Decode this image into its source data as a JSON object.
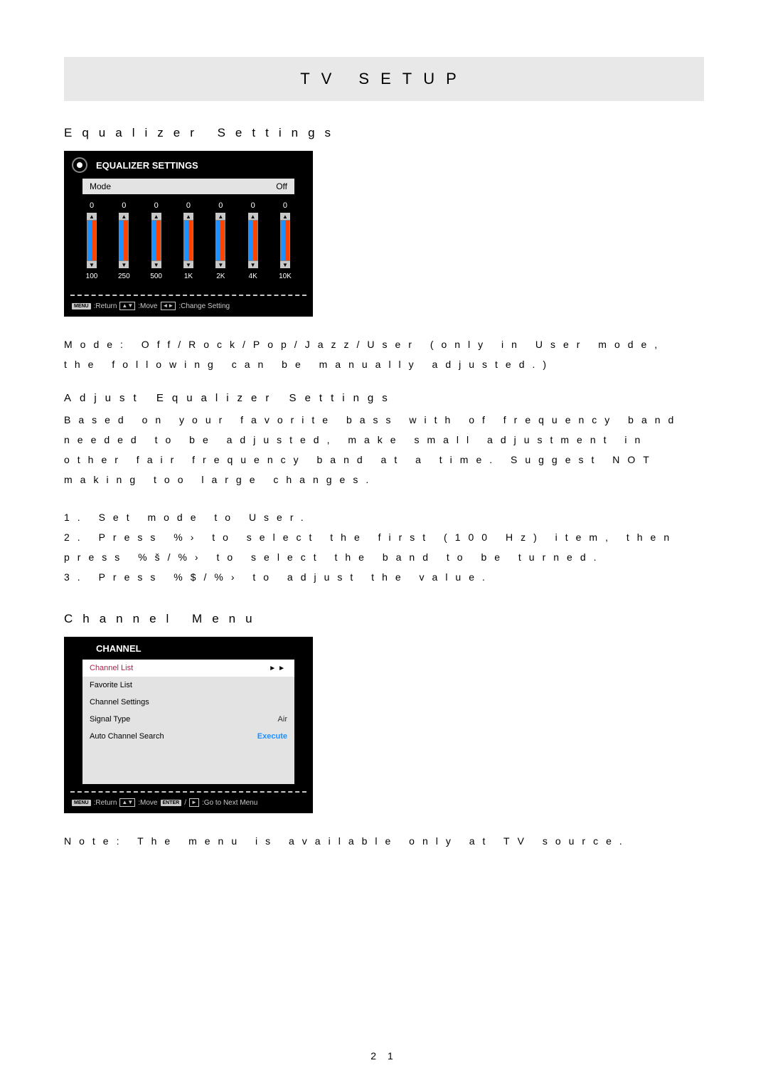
{
  "title": "TV SETUP",
  "equalizer": {
    "heading": "Equalizer Settings",
    "panel_title": "EQUALIZER SETTINGS",
    "mode_label": "Mode",
    "mode_value": "Off",
    "bands": [
      {
        "value": "0",
        "freq": "100"
      },
      {
        "value": "0",
        "freq": "250"
      },
      {
        "value": "0",
        "freq": "500"
      },
      {
        "value": "0",
        "freq": "1K"
      },
      {
        "value": "0",
        "freq": "2K"
      },
      {
        "value": "0",
        "freq": "4K"
      },
      {
        "value": "0",
        "freq": "10K"
      }
    ],
    "footer_return": ":Return",
    "footer_move": ":Move",
    "footer_change": ":Change Setting",
    "key_menu": "MENU"
  },
  "mode_text": "Mode: Off/Rock/Pop/Jazz/User (only in User mode, the following can be manually adjusted.)",
  "adjust": {
    "heading": "Adjust Equalizer Settings",
    "text": "Based on your favorite bass with of frequency band needed to be adjusted, make small adjustment in other fair frequency band at a time. Suggest NOT making too large changes.",
    "steps": "1. Set mode to User.\n2. Press %› to select the first (100 Hz) item, then press %š/%› to select the band to be turned.\n3. Press %$/%› to adjust the value."
  },
  "channel": {
    "heading": "Channel Menu",
    "panel_title": "CHANNEL",
    "items": [
      {
        "label": "Channel List",
        "value": "",
        "arrows": "►►"
      },
      {
        "label": "Favorite List",
        "value": "",
        "arrows": ""
      },
      {
        "label": "Channel Settings",
        "value": "",
        "arrows": ""
      },
      {
        "label": "Signal Type",
        "value": "Air",
        "arrows": ""
      },
      {
        "label": "Auto Channel Search",
        "value": "Execute",
        "arrows": ""
      }
    ],
    "footer_return": ":Return",
    "footer_move": ":Move",
    "footer_next": ":Go to Next Menu",
    "key_menu": "MENU",
    "key_enter": "ENTER",
    "note": "Note: The menu is available only at TV source."
  },
  "page_number": "2 1"
}
